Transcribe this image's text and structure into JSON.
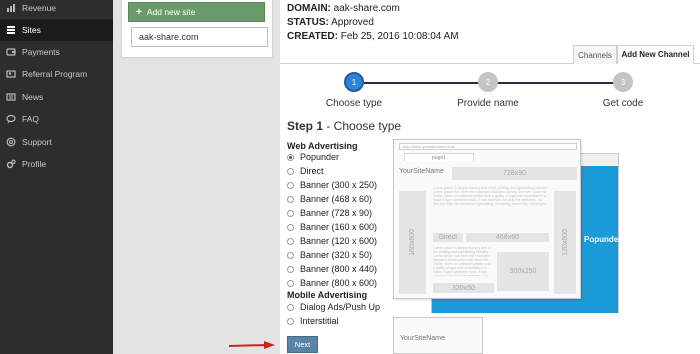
{
  "sidebar": {
    "items": [
      {
        "label": "Revenue",
        "icon": "chart-icon",
        "active": false
      },
      {
        "label": "Sites",
        "icon": "list-icon",
        "active": true
      },
      {
        "label": "Payments",
        "icon": "wallet-icon",
        "active": false
      },
      {
        "label": "Referral Program",
        "icon": "users-icon",
        "active": false
      },
      {
        "label": "News",
        "icon": "newspaper-icon",
        "active": false
      },
      {
        "label": "FAQ",
        "icon": "chat-icon",
        "active": false
      },
      {
        "label": "Support",
        "icon": "support-icon",
        "active": false
      },
      {
        "label": "Profile",
        "icon": "gears-icon",
        "active": false
      }
    ]
  },
  "sites_panel": {
    "add_button": "Add new site",
    "sites": [
      "aak-share.com"
    ]
  },
  "site_info": {
    "domain_label": "DOMAIN:",
    "domain_value": "aak-share.com",
    "status_label": "STATUS:",
    "status_value": "Approved",
    "created_label": "CREATED:",
    "created_value": "Feb 25, 2016 10:08:04 AM"
  },
  "tabs": {
    "channels": "Channels",
    "add_new_channel": "Add New Channel"
  },
  "stepper": {
    "steps": [
      {
        "number": "1",
        "label": "Choose type",
        "active": true
      },
      {
        "number": "2",
        "label": "Provide name",
        "active": false
      },
      {
        "number": "3",
        "label": "Get code",
        "active": false
      }
    ]
  },
  "step_title": {
    "prefix": "Step 1",
    "text": " - Choose type"
  },
  "web_advertising": {
    "heading": "Web Advertising",
    "options": [
      {
        "label": "Popunder",
        "checked": true
      },
      {
        "label": "Direct",
        "checked": false
      },
      {
        "label": "Banner (300 x 250)",
        "checked": false
      },
      {
        "label": "Banner (468 x 60)",
        "checked": false
      },
      {
        "label": "Banner (728 x 90)",
        "checked": false
      },
      {
        "label": "Banner (160 x 600)",
        "checked": false
      },
      {
        "label": "Banner (120 x 600)",
        "checked": false
      },
      {
        "label": "Banner (320 x 50)",
        "checked": false
      },
      {
        "label": "Banner (800 x 440)",
        "checked": false
      },
      {
        "label": "Banner (800 x 600)",
        "checked": false
      }
    ]
  },
  "mobile_advertising": {
    "heading": "Mobile Advertising",
    "options": [
      {
        "label": "Dialog Ads/Push Up",
        "checked": false
      },
      {
        "label": "Interstitial",
        "checked": false
      }
    ]
  },
  "next_button": "Next",
  "preview": {
    "url": "http://www.yoursitename.com",
    "page_tab": "page1",
    "site_name": "YourSiteName",
    "site_name_2": "YourSiteName",
    "popunder": "Popunder",
    "slots": {
      "top_banner": "728x90",
      "left_skyscraper": "160x600",
      "right_skyscraper": "120x600",
      "direct": "Direct",
      "middle_banner": "468x60",
      "rectangle": "300x250",
      "mobile_banner": "320x50"
    },
    "filler_text": "Lorem ipsum is simply dummy text of the printing and typesetting industry. Lorem ipsum has been the industry's standard dummy text ever since the 1500s, when an unknown printer took a galley of type and scrambled it to make a type specimen book. It has survived not only five centuries, but also the leap into electronic typesetting, remaining essentially unchanged."
  },
  "colors": {
    "sidebar_bg": "#2d2d2d",
    "active_step": "#2b84d8",
    "popunder_blue": "#1a9ad6",
    "add_button": "#6a9c6a",
    "next_button": "#5b83a8",
    "arrow": "#cc2222"
  }
}
